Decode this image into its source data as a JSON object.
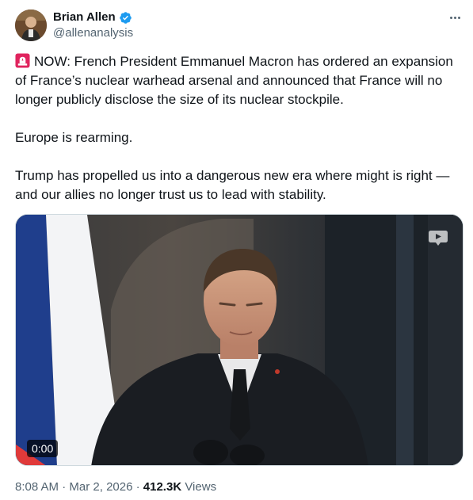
{
  "author": {
    "display_name": "Brian Allen",
    "handle": "@allenanalysis",
    "verified": true
  },
  "tweet": {
    "paragraphs": [
      "NOW: French President Emmanuel Macron has ordered an expansion of France’s nuclear warhead arsenal and announced that France will no longer publicly disclose the size of its nuclear stockpile.",
      "Europe is rearming.",
      "Trump has propelled us into a dangerous new era where might is right — and our allies no longer trust us to lead with stability."
    ],
    "leading_emoji": "siren-icon"
  },
  "media": {
    "type": "video",
    "duration_label": "0:00"
  },
  "meta": {
    "time": "8:08 AM",
    "separator": "·",
    "date": "Mar 2, 2026",
    "views_count": "412.3K",
    "views_label": "Views"
  },
  "colors": {
    "text_primary": "#0f1419",
    "text_secondary": "#536471",
    "verified_blue": "#1d9bf0",
    "siren_red": "#e0245e",
    "flag_blue": "#1f3e8c",
    "flag_red": "#e03a3a"
  }
}
